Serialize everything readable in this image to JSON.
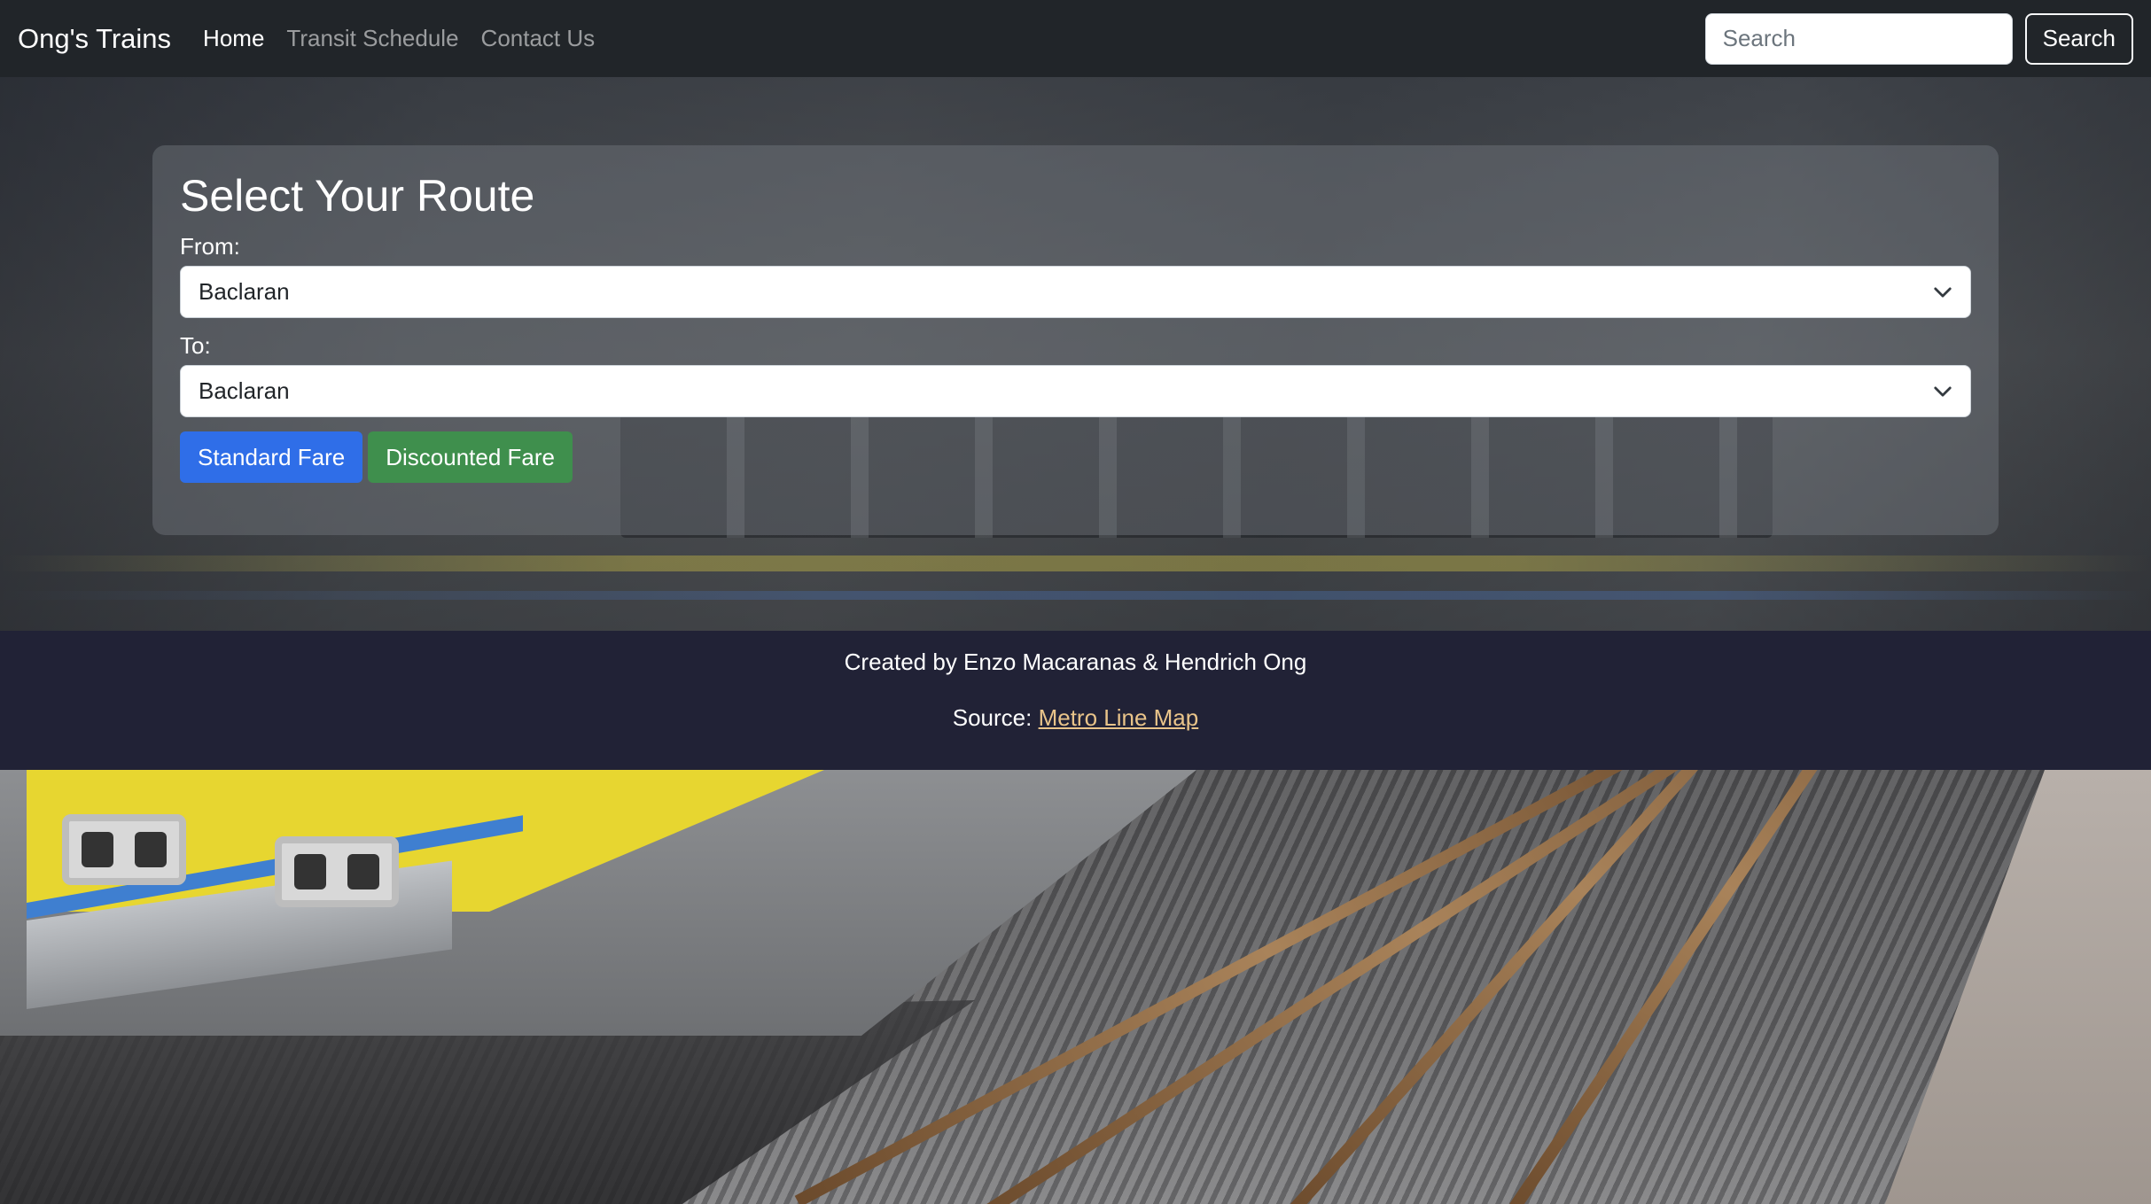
{
  "navbar": {
    "brand": "Ong's Trains",
    "links": [
      {
        "label": "Home",
        "active": true
      },
      {
        "label": "Transit Schedule",
        "active": false
      },
      {
        "label": "Contact Us",
        "active": false
      }
    ],
    "search": {
      "placeholder": "Search",
      "value": "",
      "button_label": "Search"
    }
  },
  "route_form": {
    "title": "Select Your Route",
    "from": {
      "label": "From:",
      "selected": "Baclaran"
    },
    "to": {
      "label": "To:",
      "selected": "Baclaran"
    },
    "buttons": {
      "standard": "Standard Fare",
      "discounted": "Discounted Fare"
    }
  },
  "footer": {
    "credit": "Created by Enzo Macaranas & Hendrich Ong",
    "source_prefix": "Source: ",
    "source_link": "Metro Line Map"
  },
  "colors": {
    "navbar_bg": "#212529",
    "primary": "#2f6ee8",
    "success": "#3f8f4d",
    "footer_bg": "#212236",
    "link": "#e9c48a"
  },
  "icons": {
    "select_chevron": "chevron-down-icon"
  }
}
